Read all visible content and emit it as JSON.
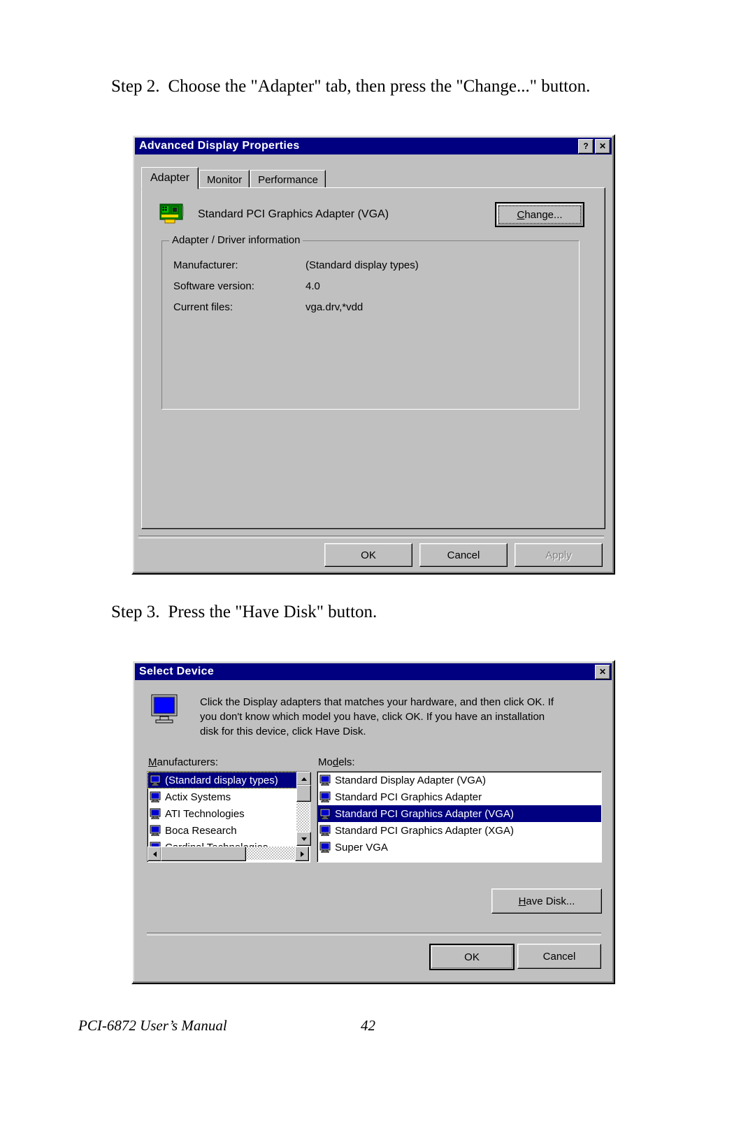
{
  "page": {
    "step2_label": "Step 2.",
    "step2_text": "Choose the \"Adapter\" tab, then press the \"Change...\" button.",
    "step3_label": "Step 3.",
    "step3_text": "Press the \"Have Disk\" button.",
    "footer_title": "PCI-6872 User’s Manual",
    "footer_page": "42"
  },
  "colors": {
    "titlebar": "#000080",
    "face": "#c0c0c0",
    "selection": "#000080",
    "disabled_text": "#808080"
  },
  "advanced_display_properties": {
    "title": "Advanced Display Properties",
    "help_button": "?",
    "close_button": "✕",
    "tabs": [
      {
        "label": "Adapter",
        "active": true
      },
      {
        "label": "Monitor",
        "active": false
      },
      {
        "label": "Performance",
        "active": false
      }
    ],
    "adapter_name": "Standard PCI Graphics Adapter (VGA)",
    "change_button": {
      "prefix": "C",
      "rest": "hange..."
    },
    "group": {
      "title": "Adapter / Driver information",
      "rows": [
        {
          "label": "Manufacturer:",
          "value": "(Standard display types)"
        },
        {
          "label": "Software version:",
          "value": "4.0"
        },
        {
          "label": "Current files:",
          "value": "vga.drv,*vdd"
        }
      ]
    },
    "buttons": [
      {
        "label": "OK",
        "disabled": false
      },
      {
        "label": "Cancel",
        "disabled": false
      },
      {
        "label": "Apply",
        "disabled": true
      }
    ]
  },
  "select_device": {
    "title": "Select Device",
    "close_button": "✕",
    "description": [
      "Click the Display adapters that matches your hardware, and then click OK. If",
      "you don't know which model you have, click OK. If you have an installation",
      "disk for this device, click Have Disk."
    ],
    "manufacturers_label": {
      "prefix": "M",
      "rest": "anufacturers:"
    },
    "models_label": {
      "prefix": "Mo",
      "mid": "d",
      "rest": "els:"
    },
    "manufacturers": [
      {
        "name": "(Standard display types)",
        "selected": true
      },
      {
        "name": "Actix Systems",
        "selected": false
      },
      {
        "name": "ATI Technologies",
        "selected": false
      },
      {
        "name": "Boca Research",
        "selected": false
      },
      {
        "name": "Cardinal Technologies",
        "selected": false
      }
    ],
    "models": [
      {
        "name": "Standard Display Adapter (VGA)",
        "selected": false
      },
      {
        "name": "Standard PCI Graphics Adapter",
        "selected": false
      },
      {
        "name": "Standard PCI Graphics Adapter (VGA)",
        "selected": true
      },
      {
        "name": "Standard PCI Graphics Adapter (XGA)",
        "selected": false
      },
      {
        "name": "Super VGA",
        "selected": false
      }
    ],
    "have_disk_button": {
      "prefix": "H",
      "rest": "ave Disk..."
    },
    "buttons": [
      {
        "label": "OK"
      },
      {
        "label": "Cancel"
      }
    ]
  }
}
